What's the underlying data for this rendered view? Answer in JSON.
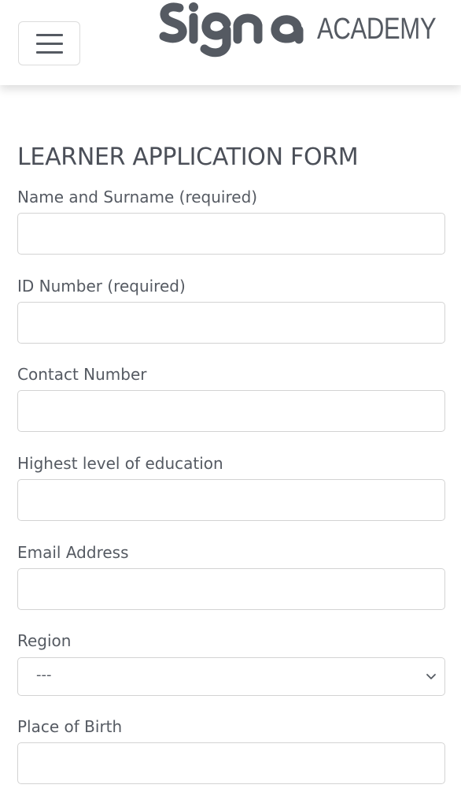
{
  "header": {
    "menu_icon": "hamburger-menu-icon",
    "logo_wordmark": "signa",
    "logo_text": "ACADEMY"
  },
  "form": {
    "title": "LEARNER APPLICATION FORM",
    "fields": [
      {
        "label": "Name and Surname (required)",
        "value": ""
      },
      {
        "label": "ID Number (required)",
        "value": ""
      },
      {
        "label": "Contact Number",
        "value": ""
      },
      {
        "label": "Highest level of education",
        "value": ""
      },
      {
        "label": "Email Address",
        "value": ""
      },
      {
        "label": "Region",
        "selected": "---",
        "icon": "chevron-down-icon"
      },
      {
        "label": "Place of Birth",
        "value": ""
      }
    ]
  },
  "colors": {
    "text": "#4b4f58",
    "border": "#d3d3d3",
    "logo": "#555a62"
  }
}
